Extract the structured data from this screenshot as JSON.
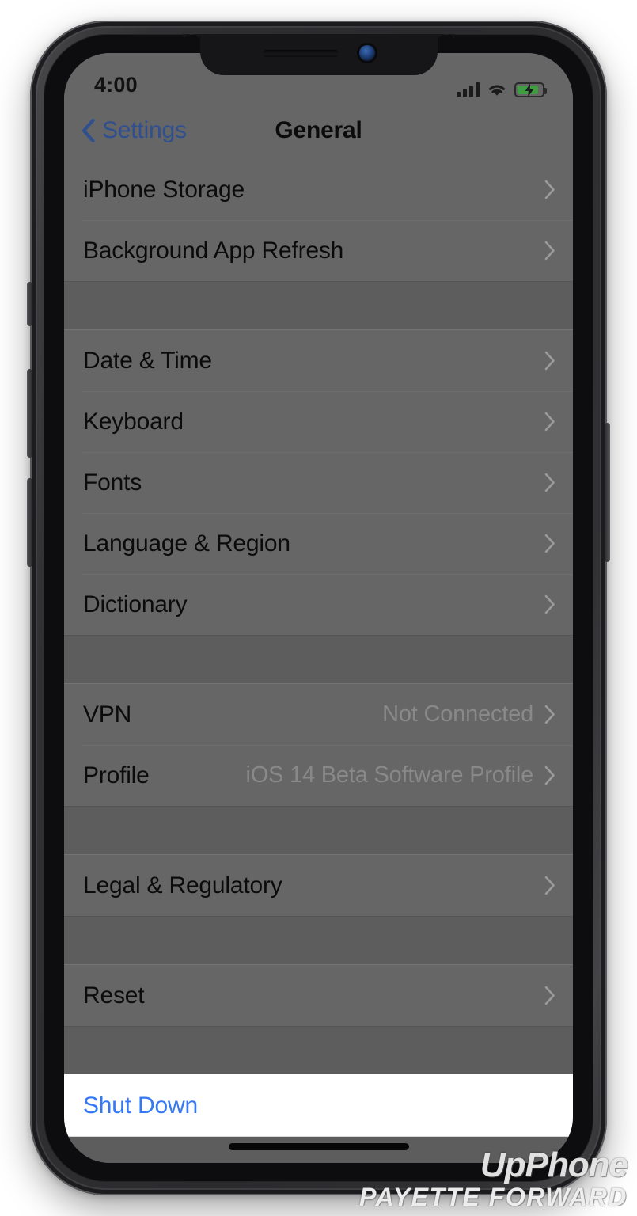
{
  "status_bar": {
    "time": "4:00",
    "signal_icon": "cellular-signal-icon",
    "wifi_icon": "wifi-icon",
    "battery_icon": "battery-charging-icon",
    "battery_state": "charging"
  },
  "nav_bar": {
    "back_label": "Settings",
    "back_icon": "chevron-left-icon",
    "title": "General"
  },
  "colors": {
    "accent_blue": "#3478f6",
    "dimmed_blue": "#2f4f8f",
    "dimmed_row_bg": "#666666",
    "dimmed_group_bg": "#5d5d5d",
    "highlight_bg": "#ffffff",
    "battery_green": "#3f9e3f"
  },
  "groups": [
    {
      "clipped_top": true,
      "rows": [
        {
          "label": "iPhone Storage",
          "value": "",
          "chevron": true
        },
        {
          "label": "Background App Refresh",
          "value": "",
          "chevron": true
        }
      ]
    },
    {
      "clipped_top": false,
      "rows": [
        {
          "label": "Date & Time",
          "value": "",
          "chevron": true
        },
        {
          "label": "Keyboard",
          "value": "",
          "chevron": true
        },
        {
          "label": "Fonts",
          "value": "",
          "chevron": true
        },
        {
          "label": "Language & Region",
          "value": "",
          "chevron": true
        },
        {
          "label": "Dictionary",
          "value": "",
          "chevron": true
        }
      ]
    },
    {
      "clipped_top": false,
      "rows": [
        {
          "label": "VPN",
          "value": "Not Connected",
          "chevron": true
        },
        {
          "label": "Profile",
          "value": "iOS 14 Beta Software Profile",
          "chevron": true
        }
      ]
    },
    {
      "clipped_top": false,
      "rows": [
        {
          "label": "Legal & Regulatory",
          "value": "",
          "chevron": true
        }
      ]
    },
    {
      "clipped_top": false,
      "rows": [
        {
          "label": "Reset",
          "value": "",
          "chevron": true
        }
      ]
    },
    {
      "clipped_top": false,
      "highlight": true,
      "rows": [
        {
          "label": "Shut Down",
          "value": "",
          "chevron": false
        }
      ]
    }
  ],
  "hardware": {
    "speaker_icon": "earpiece-speaker-icon",
    "camera_icon": "front-camera-icon",
    "mute_switch": "mute-switch-button",
    "volume_up": "volume-up-button",
    "volume_down": "volume-down-button",
    "side_button": "side-power-button",
    "home_indicator": "home-indicator"
  },
  "watermark": {
    "line1": "UpPhone",
    "line2": "PAYETTE FORWARD"
  }
}
